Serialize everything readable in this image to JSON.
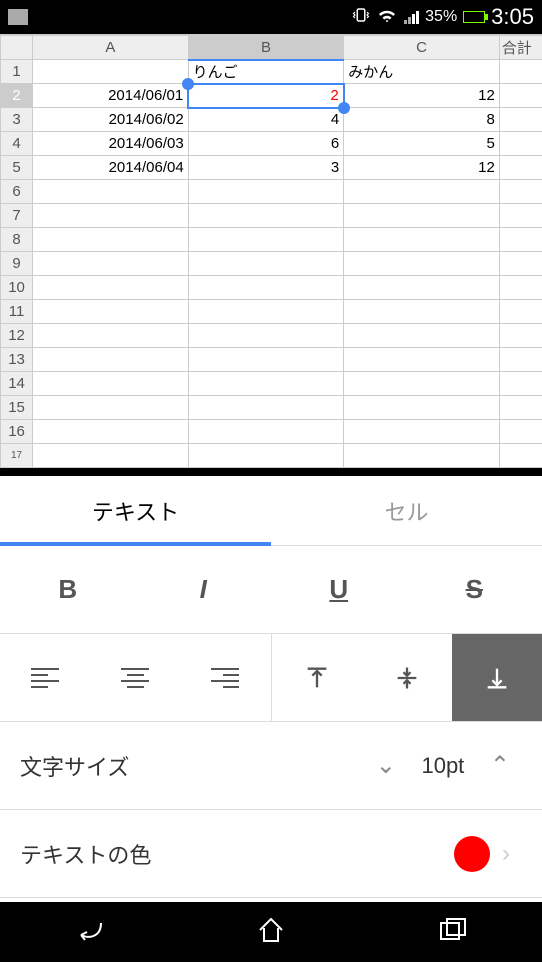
{
  "statusbar": {
    "battery_percent": "35%",
    "time": "3:05"
  },
  "sheet": {
    "cols": [
      "A",
      "B",
      "C"
    ],
    "corner_col": "合計",
    "rows": [
      {
        "n": "1",
        "a": "",
        "b": "りんご",
        "c": "みかん"
      },
      {
        "n": "2",
        "a": "2014/06/01",
        "b": "2",
        "c": "12"
      },
      {
        "n": "3",
        "a": "2014/06/02",
        "b": "4",
        "c": "8"
      },
      {
        "n": "4",
        "a": "2014/06/03",
        "b": "6",
        "c": "5"
      },
      {
        "n": "5",
        "a": "2014/06/04",
        "b": "3",
        "c": "12"
      }
    ],
    "selected_cell": "B2"
  },
  "panel": {
    "tabs": {
      "text": "テキスト",
      "cell": "セル",
      "active": "text"
    },
    "size_label": "文字サイズ",
    "size_value": "10pt",
    "color_label": "テキストの色",
    "color_value": "#ff0000"
  }
}
